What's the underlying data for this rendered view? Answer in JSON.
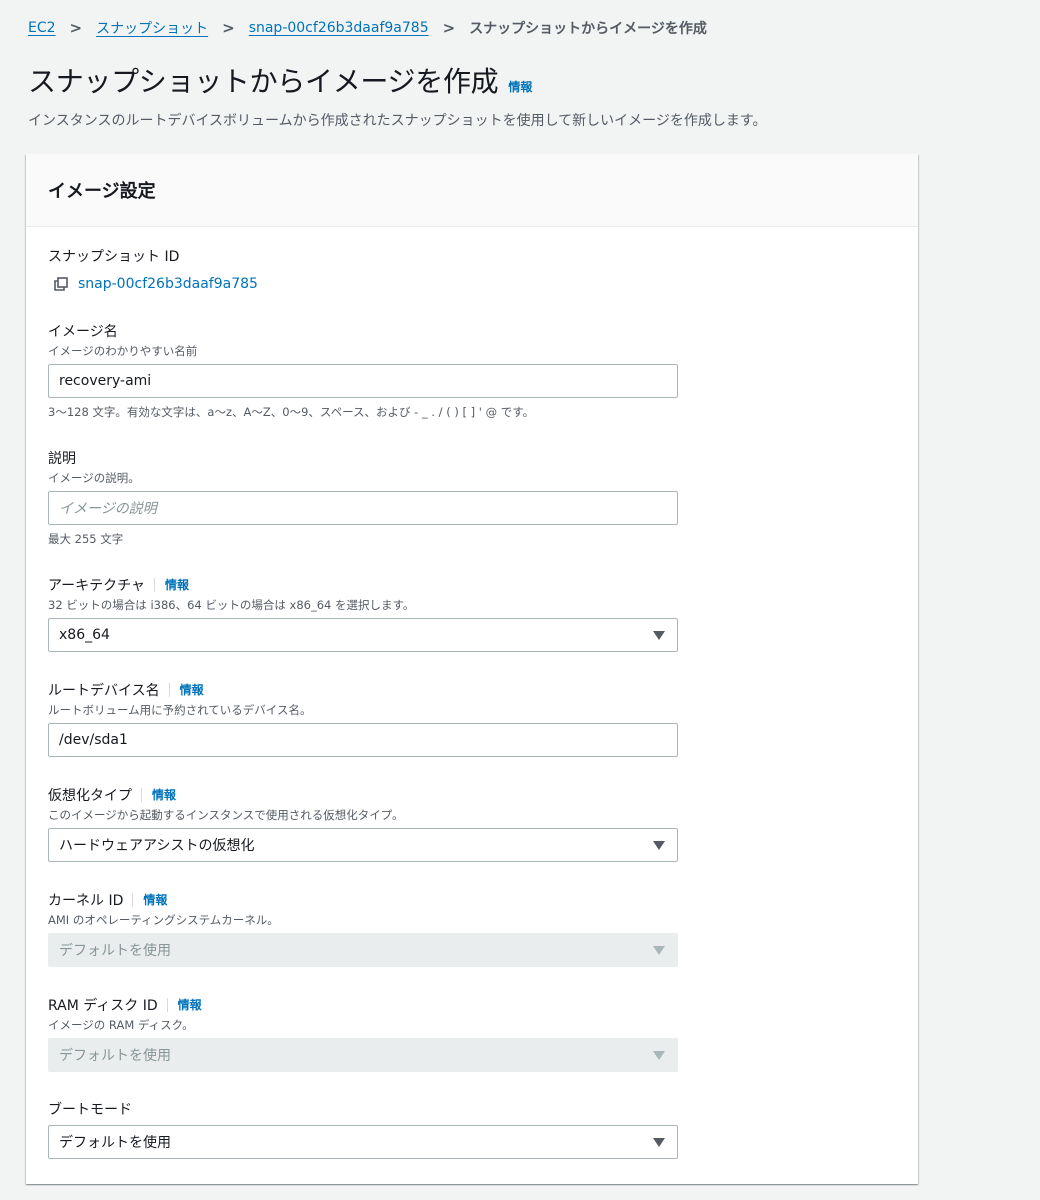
{
  "breadcrumb": {
    "ec2": "EC2",
    "snapshots": "スナップショット",
    "snapshot_id": "snap-00cf26b3daaf9a785",
    "current": "スナップショットからイメージを作成"
  },
  "header": {
    "title": "スナップショットからイメージを作成",
    "info": "情報",
    "description": "インスタンスのルートデバイスボリュームから作成されたスナップショットを使用して新しいイメージを作成します。"
  },
  "panel": {
    "title": "イメージ設定",
    "snapshot": {
      "label": "スナップショット ID",
      "value": "snap-00cf26b3daaf9a785",
      "icon": "copy-icon"
    },
    "image_name": {
      "label": "イメージ名",
      "description": "イメージのわかりやすい名前",
      "value": "recovery-ami",
      "constraint": "3〜128 文字。有効な文字は、a〜z、A〜Z、0〜9、スペース、および - _ . / ( ) [ ] ' @ です。"
    },
    "description_field": {
      "label": "説明",
      "description": "イメージの説明。",
      "placeholder": "イメージの説明",
      "constraint": "最大 255 文字"
    },
    "architecture": {
      "label": "アーキテクチャ",
      "info": "情報",
      "description": "32 ビットの場合は i386、64 ビットの場合は x86_64 を選択します。",
      "value": "x86_64"
    },
    "root_device": {
      "label": "ルートデバイス名",
      "info": "情報",
      "description": "ルートボリューム用に予約されているデバイス名。",
      "value": "/dev/sda1"
    },
    "virtualization": {
      "label": "仮想化タイプ",
      "info": "情報",
      "description": "このイメージから起動するインスタンスで使用される仮想化タイプ。",
      "value": "ハードウェアアシストの仮想化"
    },
    "kernel": {
      "label": "カーネル ID",
      "info": "情報",
      "description": "AMI のオペレーティングシステムカーネル。",
      "value": "デフォルトを使用"
    },
    "ramdisk": {
      "label": "RAM ディスク ID",
      "info": "情報",
      "description": "イメージの RAM ディスク。",
      "value": "デフォルトを使用"
    },
    "boot_mode": {
      "label": "ブートモード",
      "value": "デフォルトを使用"
    }
  }
}
